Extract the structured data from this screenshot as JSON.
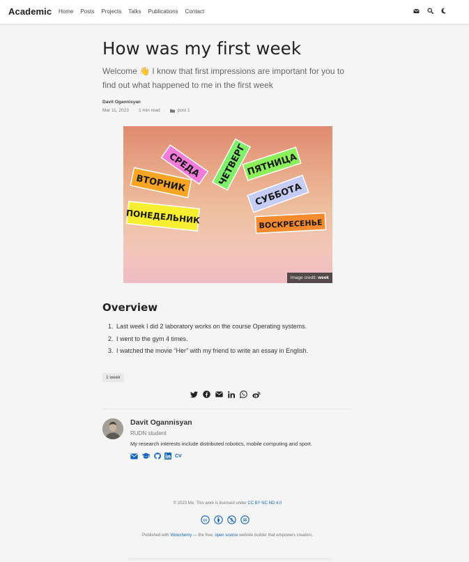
{
  "nav": {
    "brand": "Academic",
    "links": [
      "Home",
      "Posts",
      "Projects",
      "Talks",
      "Publications",
      "Contact"
    ],
    "icons": [
      "envelope-icon",
      "search-icon",
      "moon-icon"
    ]
  },
  "article": {
    "title": "How was my first week",
    "subtitle_before": "Welcome ",
    "subtitle_emoji": "👋",
    "subtitle_after": " I know that first impressions are important for you to find out what happened to me in the first week",
    "author": "Davit Ogannisyan",
    "date": "Mar 11, 2023",
    "read_time": "1 min read",
    "category": "post 1",
    "image_words": [
      "СРЕДА",
      "ЧЕТВЕРГ",
      "ПЯТНИЦА",
      "ВТОРНИК",
      "СУББОТА",
      "ПОНЕДЕЛЬНИК",
      "ВОСКРЕСЕНЬЕ"
    ],
    "image_credit_label": "Image credit:",
    "image_credit_value": "week",
    "section_heading": "Overview",
    "list": [
      "Last week I did 2 laboratory works on the course Operating systems.",
      "I went to the gym 4 times.",
      "I watched the movie “Her” with my friend to write an essay in English."
    ],
    "tag": "1 week"
  },
  "share_icons": [
    "twitter-icon",
    "facebook-icon",
    "envelope-icon",
    "linkedin-icon",
    "whatsapp-icon",
    "weibo-icon"
  ],
  "bio": {
    "name": "Davit Ogannisyan",
    "role": "RUDN student",
    "text": "My research interests include distributed robotics, mobile computing and sport.",
    "cv_label": "CV"
  },
  "footer": {
    "copyright": "© 2023 Me. This work is licensed under ",
    "license": "CC BY NC ND 4.0",
    "published_before": "Published with ",
    "wowchemy": "Wowchemy",
    "published_mid": " — the free, ",
    "open_source": "open source",
    "published_after": " website builder that empowers creators."
  },
  "colors": {
    "accent": "#1565c0",
    "brand_text": "#1e1e1e",
    "page_bg": "#f5f5f5"
  }
}
